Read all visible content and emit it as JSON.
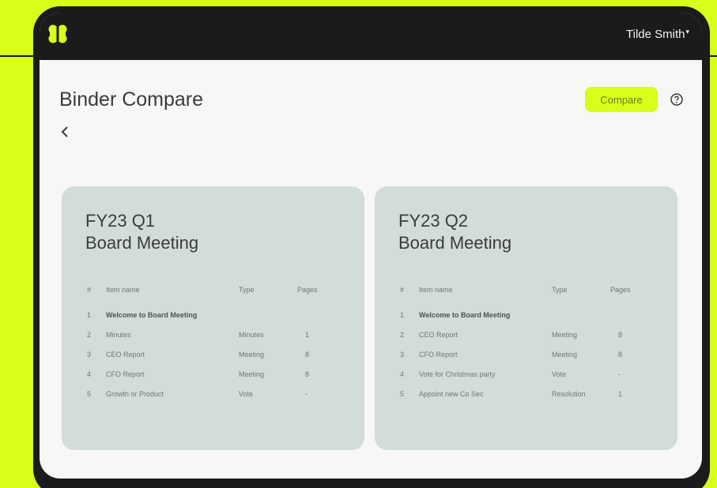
{
  "header": {
    "user_name": "Tilde Smith",
    "user_caret": "▾"
  },
  "page": {
    "title": "Binder Compare",
    "compare_label": "Compare"
  },
  "columns": {
    "num": "#",
    "name": "Item name",
    "type": "Type",
    "pages": "Pages"
  },
  "binders": [
    {
      "title_line1": "FY23 Q1",
      "title_line2": "Board Meeting",
      "rows": [
        {
          "num": "1",
          "name": "Welcome to Board Meeting",
          "type": "",
          "pages": ""
        },
        {
          "num": "2",
          "name": "Minutes",
          "type": "Minutes",
          "pages": "1"
        },
        {
          "num": "3",
          "name": "CEO Report",
          "type": "Meeting",
          "pages": "8"
        },
        {
          "num": "4",
          "name": "CFO Report",
          "type": "Meeting",
          "pages": "8"
        },
        {
          "num": "5",
          "name": "Growth or Product",
          "type": "Vote",
          "pages": "-"
        }
      ]
    },
    {
      "title_line1": "FY23 Q2",
      "title_line2": "Board Meeting",
      "rows": [
        {
          "num": "1",
          "name": "Welcome to Board Meeting",
          "type": "",
          "pages": ""
        },
        {
          "num": "2",
          "name": "CEO Report",
          "type": "Meeting",
          "pages": "8"
        },
        {
          "num": "3",
          "name": "CFO Report",
          "type": "Meeting",
          "pages": "8"
        },
        {
          "num": "4",
          "name": "Vote for Christmas party",
          "type": "Vote",
          "pages": "-"
        },
        {
          "num": "5",
          "name": "Appoint new Co Sec",
          "type": "Resolution",
          "pages": "1"
        }
      ]
    }
  ],
  "colors": {
    "accent": "#d8ff1a",
    "card": "#d3ddd8",
    "dark": "#1b1b1b"
  }
}
